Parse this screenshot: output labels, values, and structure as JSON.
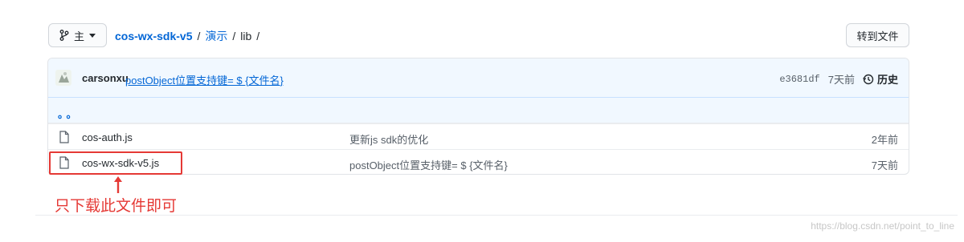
{
  "topbar": {
    "branch_label": "主",
    "breadcrumb": {
      "repo": "cos-wx-sdk-v5",
      "sep": "/",
      "folder": "演示",
      "current": "lib"
    },
    "goto_file_label": "转到文件"
  },
  "commit": {
    "author": "carsonxu",
    "message": "postObject位置支持键= $ {文件名}",
    "sha": "e3681df",
    "ago": "7天前",
    "history_label": "历史"
  },
  "parent": {
    "label": "。。"
  },
  "files": [
    {
      "name": "cos-auth.js",
      "message": "更新js sdk的优化",
      "age": "2年前"
    },
    {
      "name": "cos-wx-sdk-v5.js",
      "message": "postObject位置支持键= $ {文件名}",
      "age": "7天前"
    }
  ],
  "annotation": {
    "text": "只下载此文件即可",
    "color": "#e53935"
  },
  "watermark": "https://blog.csdn.net/point_to_line",
  "colors": {
    "link": "#0366d6",
    "commit_bg": "#f1f8ff",
    "annotation_red": "#e53935"
  }
}
